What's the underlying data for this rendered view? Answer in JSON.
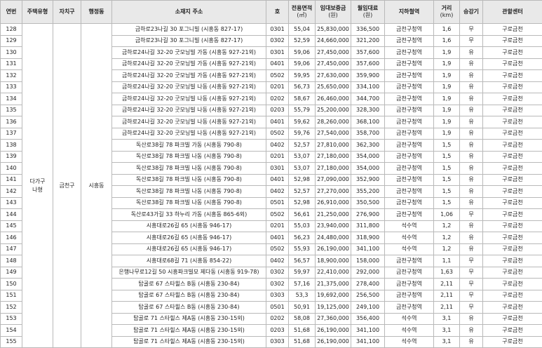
{
  "headers": [
    "연번",
    "주택유형",
    "자치구",
    "행정동",
    "소재지 주소",
    "호",
    "전용면적",
    "(㎡)",
    "임대보증금",
    "(원)",
    "월임대료",
    "(원)",
    "지하철역",
    "거리",
    "(km)",
    "승강기",
    "관할센터"
  ],
  "merged": {
    "type": "다가구\n나형",
    "district": "금천구",
    "dong": "시흥동"
  },
  "rows": [
    [
      "128",
      "금하로23나길 30 포그니빌 (시흥동 827-17)",
      "0301",
      "55,04",
      "25,830,000",
      "336,500",
      "금천구청역",
      "1,6",
      "무",
      "구로금천"
    ],
    [
      "129",
      "금하로23나길 30 포그니빌 (시흥동 827-17)",
      "0302",
      "52,59",
      "24,660,000",
      "321,200",
      "금천구청역",
      "1,6",
      "무",
      "구로금천"
    ],
    [
      "130",
      "금하로24나길 32-20 굿모닝빌 가동 (시흥동 927-21외)",
      "0301",
      "59,06",
      "27,450,000",
      "357,600",
      "금천구청역",
      "1,9",
      "유",
      "구로금천"
    ],
    [
      "131",
      "금하로24나길 32-20 굿모닝빌 가동 (시흥동 927-21외)",
      "0401",
      "59,06",
      "27,450,000",
      "357,600",
      "금천구청역",
      "1,9",
      "유",
      "구로금천"
    ],
    [
      "132",
      "금하로24나길 32-20 굿모닝빌 가동 (시흥동 927-21외)",
      "0502",
      "59,95",
      "27,630,000",
      "359,900",
      "금천구청역",
      "1,9",
      "유",
      "구로금천"
    ],
    [
      "133",
      "금하로24나길 32-20 굿모닝빌 나동 (시흥동 927-21외)",
      "0201",
      "56,73",
      "25,650,000",
      "334,100",
      "금천구청역",
      "1,9",
      "유",
      "구로금천"
    ],
    [
      "134",
      "금하로24나길 32-20 굿모닝빌 나동 (시흥동 927-21외)",
      "0202",
      "58,67",
      "26,460,000",
      "344,700",
      "금천구청역",
      "1,9",
      "유",
      "구로금천"
    ],
    [
      "135",
      "금하로24나길 32-20 굿모닝빌 나동 (시흥동 927-21외)",
      "0203",
      "55,79",
      "25,200,000",
      "328,300",
      "금천구청역",
      "1,9",
      "유",
      "구로금천"
    ],
    [
      "136",
      "금하로24나길 32-20 굿모닝빌 나동 (시흥동 927-21외)",
      "0401",
      "59,62",
      "28,260,000",
      "368,100",
      "금천구청역",
      "1,9",
      "유",
      "구로금천"
    ],
    [
      "137",
      "금하로24나길 32-20 굿모닝빌 나동 (시흥동 927-21외)",
      "0502",
      "59,76",
      "27,540,000",
      "358,700",
      "금천구청역",
      "1,9",
      "유",
      "구로금천"
    ],
    [
      "138",
      "독산로38길 78 파크빌 가동 (시흥동 790-8)",
      "0402",
      "52,57",
      "27,810,000",
      "362,300",
      "금천구청역",
      "1,5",
      "유",
      "구로금천"
    ],
    [
      "139",
      "독산로38길 78 파크빌 나동 (시흥동 790-8)",
      "0201",
      "53,07",
      "27,180,000",
      "354,000",
      "금천구청역",
      "1,5",
      "유",
      "구로금천"
    ],
    [
      "140",
      "독산로38길 78 파크빌 나동 (시흥동 790-8)",
      "0301",
      "53,07",
      "27,180,000",
      "354,000",
      "금천구청역",
      "1,5",
      "유",
      "구로금천"
    ],
    [
      "141",
      "독산로38길 78 파크빌 나동 (시흥동 790-8)",
      "0401",
      "52,98",
      "27,090,000",
      "352,900",
      "금천구청역",
      "1,5",
      "유",
      "구로금천"
    ],
    [
      "142",
      "독산로38길 78 파크빌 나동 (시흥동 790-8)",
      "0402",
      "52,57",
      "27,270,000",
      "355,200",
      "금천구청역",
      "1,5",
      "유",
      "구로금천"
    ],
    [
      "143",
      "독산로38길 78 파크빌 나동 (시흥동 790-8)",
      "0501",
      "52,98",
      "26,910,000",
      "350,500",
      "금천구청역",
      "1,5",
      "유",
      "구로금천"
    ],
    [
      "144",
      "독산로43가길 33 하누리 가동 (시흥동 865-6외)",
      "0502",
      "56,61",
      "21,250,000",
      "276,900",
      "금천구청역",
      "1,06",
      "무",
      "구로금천"
    ],
    [
      "145",
      "시흥대로26길 65 (시흥동 946-17)",
      "0201",
      "55,03",
      "23,940,000",
      "311,800",
      "석수역",
      "1,2",
      "유",
      "구로금천"
    ],
    [
      "146",
      "시흥대로26길 65 (시흥동 946-17)",
      "0401",
      "56,23",
      "24,480,000",
      "318,900",
      "석수역",
      "1,2",
      "유",
      "구로금천"
    ],
    [
      "147",
      "시흥대로26길 65 (시흥동 946-17)",
      "0502",
      "55,93",
      "26,190,000",
      "341,100",
      "석수역",
      "1,2",
      "유",
      "구로금천"
    ],
    [
      "148",
      "시흥대로68길 71 (시흥동 854-22)",
      "0402",
      "56,57",
      "18,900,000",
      "158,000",
      "금천구청역",
      "1,1",
      "무",
      "구로금천"
    ],
    [
      "149",
      "은행나무로12길 50 시흥파크빌모 제다동 (시흥동 919-78)",
      "0302",
      "59,97",
      "22,410,000",
      "292,000",
      "금천구청역",
      "1,63",
      "무",
      "구로금천"
    ],
    [
      "150",
      "탑골로 67 스타힐스 B동 (시흥동 230-84)",
      "0302",
      "57,16",
      "21,375,000",
      "278,400",
      "금천구청역",
      "2,11",
      "무",
      "구로금천"
    ],
    [
      "151",
      "탑골로 67 스타힐스 B동 (시흥동 230-84)",
      "0303",
      "53,3",
      "19,692,000",
      "256,500",
      "금천구청역",
      "2,11",
      "무",
      "구로금천"
    ],
    [
      "152",
      "탑골로 67 스타힐스 B동 (시흥동 230-84)",
      "0501",
      "50,91",
      "19,125,000",
      "249,100",
      "금천구청역",
      "2,11",
      "무",
      "구로금천"
    ],
    [
      "153",
      "탑골로 71 스타힐스 제A동 (시흥동 230-15외)",
      "0202",
      "58,08",
      "27,360,000",
      "356,400",
      "석수역",
      "3,1",
      "유",
      "구로금천"
    ],
    [
      "154",
      "탑골로 71 스타힐스 제A동 (시흥동 230-15외)",
      "0203",
      "51,68",
      "26,190,000",
      "341,100",
      "석수역",
      "3,1",
      "유",
      "구로금천"
    ],
    [
      "155",
      "탑골로 71 스타힐스 제A동 (시흥동 230-15외)",
      "0303",
      "51,68",
      "26,190,000",
      "341,100",
      "석수역",
      "3,1",
      "유",
      "구로금천"
    ]
  ]
}
